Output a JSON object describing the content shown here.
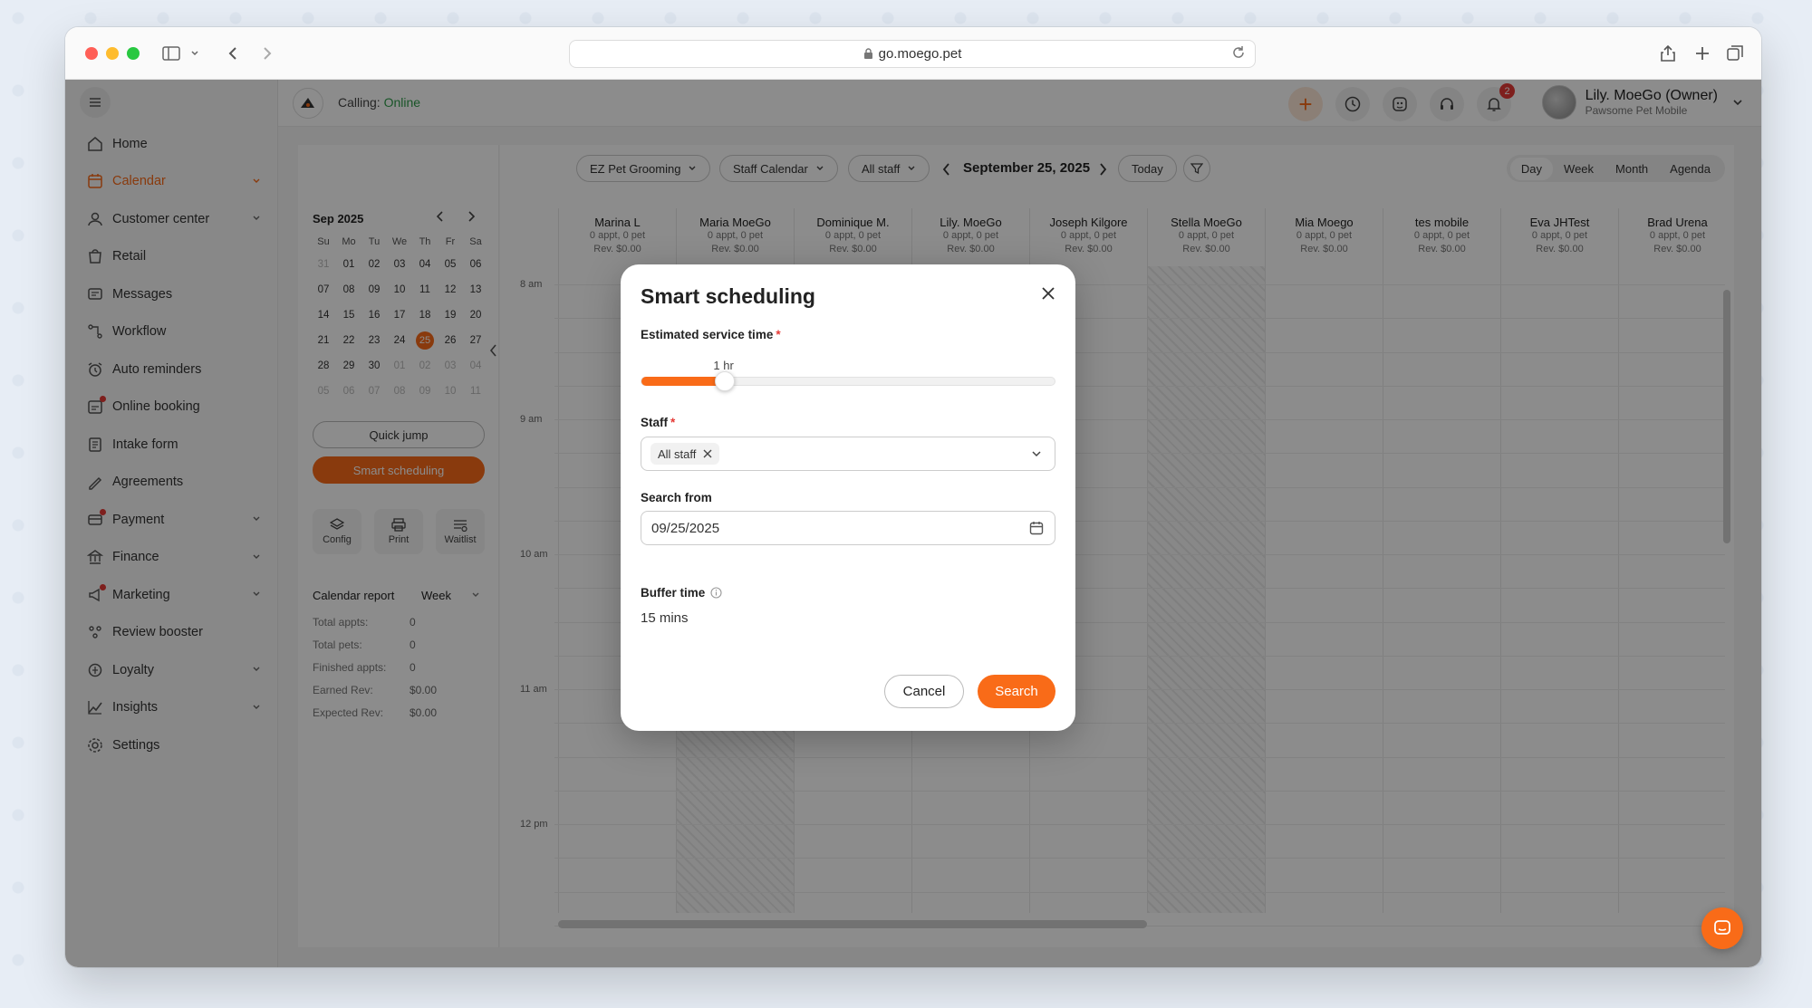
{
  "browser": {
    "url": "go.moego.pet"
  },
  "sidebar": {
    "items": [
      {
        "label": "Home",
        "icon": "home-icon",
        "chevron": false,
        "dot": false
      },
      {
        "label": "Calendar",
        "icon": "calendar-icon",
        "chevron": true,
        "dot": false,
        "active": true
      },
      {
        "label": "Customer center",
        "icon": "customer-icon",
        "chevron": true,
        "dot": false
      },
      {
        "label": "Retail",
        "icon": "retail-icon",
        "chevron": false,
        "dot": false
      },
      {
        "label": "Messages",
        "icon": "message-icon",
        "chevron": false,
        "dot": false
      },
      {
        "label": "Workflow",
        "icon": "workflow-icon",
        "chevron": false,
        "dot": false
      },
      {
        "label": "Auto reminders",
        "icon": "reminder-icon",
        "chevron": false,
        "dot": false
      },
      {
        "label": "Online booking",
        "icon": "booking-icon",
        "chevron": false,
        "dot": true
      },
      {
        "label": "Intake form",
        "icon": "form-icon",
        "chevron": false,
        "dot": false
      },
      {
        "label": "Agreements",
        "icon": "agreement-icon",
        "chevron": false,
        "dot": false
      },
      {
        "label": "Payment",
        "icon": "payment-icon",
        "chevron": true,
        "dot": true
      },
      {
        "label": "Finance",
        "icon": "finance-icon",
        "chevron": true,
        "dot": false
      },
      {
        "label": "Marketing",
        "icon": "marketing-icon",
        "chevron": true,
        "dot": true
      },
      {
        "label": "Review booster",
        "icon": "review-icon",
        "chevron": false,
        "dot": false
      },
      {
        "label": "Loyalty",
        "icon": "loyalty-icon",
        "chevron": true,
        "dot": false
      },
      {
        "label": "Insights",
        "icon": "insights-icon",
        "chevron": true,
        "dot": false
      },
      {
        "label": "Settings",
        "icon": "settings-icon",
        "chevron": false,
        "dot": false
      }
    ]
  },
  "topbar": {
    "calling_label": "Calling:",
    "calling_status": "Online",
    "notifications_count": "2",
    "user_name": "Lily. MoeGo (Owner)",
    "user_business": "Pawsome Pet Mobile"
  },
  "mini_calendar": {
    "month": "Sep 2025",
    "dow": [
      "Su",
      "Mo",
      "Tu",
      "We",
      "Th",
      "Fr",
      "Sa"
    ],
    "days": [
      {
        "d": "31",
        "muted": true
      },
      {
        "d": "01"
      },
      {
        "d": "02"
      },
      {
        "d": "03"
      },
      {
        "d": "04"
      },
      {
        "d": "05"
      },
      {
        "d": "06"
      },
      {
        "d": "07"
      },
      {
        "d": "08"
      },
      {
        "d": "09"
      },
      {
        "d": "10"
      },
      {
        "d": "11"
      },
      {
        "d": "12"
      },
      {
        "d": "13"
      },
      {
        "d": "14"
      },
      {
        "d": "15"
      },
      {
        "d": "16"
      },
      {
        "d": "17"
      },
      {
        "d": "18"
      },
      {
        "d": "19"
      },
      {
        "d": "20"
      },
      {
        "d": "21"
      },
      {
        "d": "22"
      },
      {
        "d": "23"
      },
      {
        "d": "24"
      },
      {
        "d": "25",
        "today": true
      },
      {
        "d": "26"
      },
      {
        "d": "27"
      },
      {
        "d": "28"
      },
      {
        "d": "29"
      },
      {
        "d": "30"
      },
      {
        "d": "01",
        "muted": true
      },
      {
        "d": "02",
        "muted": true
      },
      {
        "d": "03",
        "muted": true
      },
      {
        "d": "04",
        "muted": true
      },
      {
        "d": "05",
        "muted": true
      },
      {
        "d": "06",
        "muted": true
      },
      {
        "d": "07",
        "muted": true
      },
      {
        "d": "08",
        "muted": true
      },
      {
        "d": "09",
        "muted": true
      },
      {
        "d": "10",
        "muted": true
      },
      {
        "d": "11",
        "muted": true
      }
    ],
    "quick_jump": "Quick jump",
    "smart_scheduling": "Smart scheduling"
  },
  "tools": [
    {
      "label": "Config",
      "icon": "layers-icon"
    },
    {
      "label": "Print",
      "icon": "printer-icon"
    },
    {
      "label": "Waitlist",
      "icon": "waitlist-icon"
    }
  ],
  "report": {
    "title": "Calendar report",
    "period": "Week",
    "rows": [
      {
        "label": "Total appts:",
        "value": "0"
      },
      {
        "label": "Total pets:",
        "value": "0"
      },
      {
        "label": "Finished appts:",
        "value": "0"
      },
      {
        "label": "Earned Rev:",
        "value": "$0.00"
      },
      {
        "label": "Expected Rev:",
        "value": "$0.00"
      }
    ]
  },
  "calendar": {
    "business": "EZ Pet Grooming",
    "calendar_type": "Staff Calendar",
    "staff_filter": "All staff",
    "date": "September 25, 2025",
    "today": "Today",
    "views": [
      "Day",
      "Week",
      "Month",
      "Agenda"
    ],
    "selected_view": "Day",
    "staff": [
      {
        "name": "Marina L",
        "appts": "0 appt, 0 pet",
        "rev": "Rev. $0.00",
        "hatched": false
      },
      {
        "name": "Maria MoeGo",
        "appts": "0 appt, 0 pet",
        "rev": "Rev. $0.00",
        "hatched": true
      },
      {
        "name": "Dominique M.",
        "appts": "0 appt, 0 pet",
        "rev": "Rev. $0.00",
        "hatched": false
      },
      {
        "name": "Lily. MoeGo",
        "appts": "0 appt, 0 pet",
        "rev": "Rev. $0.00",
        "hatched": false
      },
      {
        "name": "Joseph Kilgore",
        "appts": "0 appt, 0 pet",
        "rev": "Rev. $0.00",
        "hatched": false
      },
      {
        "name": "Stella MoeGo",
        "appts": "0 appt, 0 pet",
        "rev": "Rev. $0.00",
        "hatched": true
      },
      {
        "name": "Mia Moego",
        "appts": "0 appt, 0 pet",
        "rev": "Rev. $0.00",
        "hatched": false
      },
      {
        "name": "tes mobile",
        "appts": "0 appt, 0 pet",
        "rev": "Rev. $0.00",
        "hatched": false
      },
      {
        "name": "Eva JHTest",
        "appts": "0 appt, 0 pet",
        "rev": "Rev. $0.00",
        "hatched": false
      },
      {
        "name": "Brad Urena",
        "appts": "0 appt, 0 pet",
        "rev": "Rev. $0.00",
        "hatched": false
      }
    ],
    "times": [
      "8 am",
      "9 am",
      "10 am",
      "11 am",
      "12 pm"
    ]
  },
  "modal": {
    "title": "Smart scheduling",
    "service_time_label": "Estimated service time",
    "service_time_value": "1 hr",
    "service_time_fraction": 0.2,
    "staff_label": "Staff",
    "staff_chip": "All staff",
    "search_from_label": "Search from",
    "search_from_value": "09/25/2025",
    "buffer_label": "Buffer time",
    "buffer_value": "15 mins",
    "cancel": "Cancel",
    "search": "Search"
  }
}
